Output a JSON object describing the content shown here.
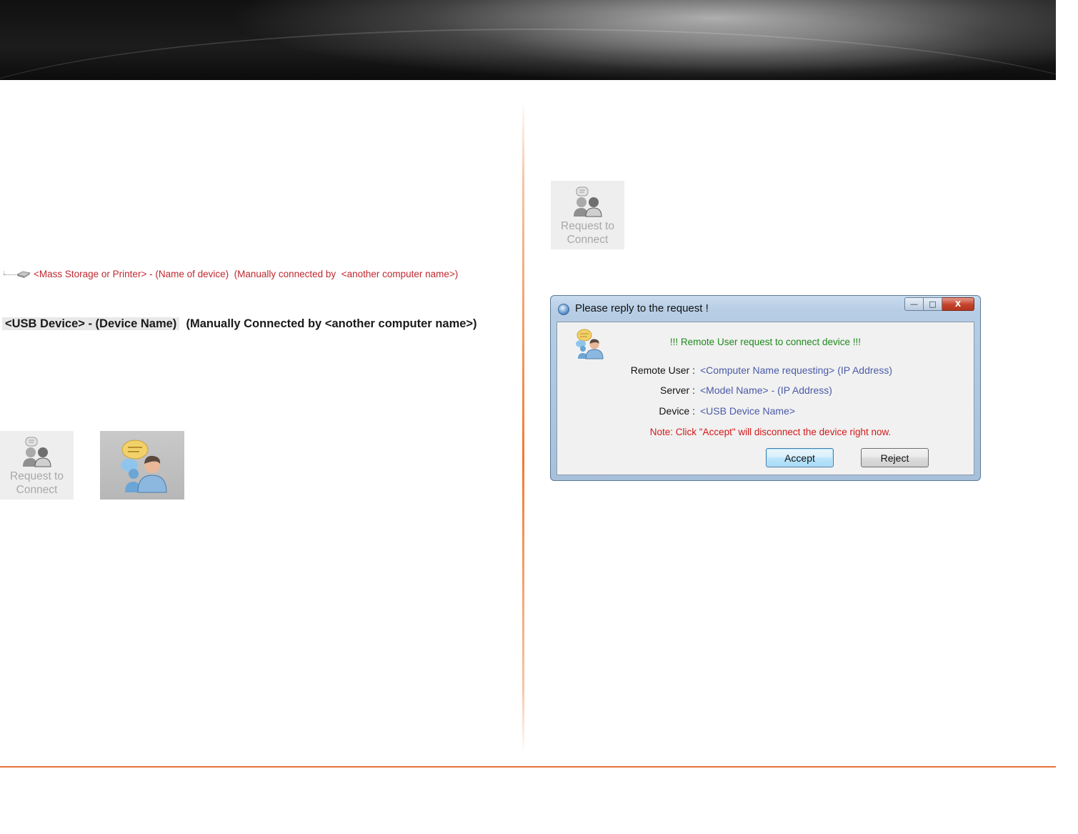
{
  "left": {
    "tree_item": "<Mass Storage or Printer> - (Name of device)  (Manually connected by  <another computer name>)",
    "usb_line": {
      "device": "<USB Device> - (Device Name)",
      "connected_label": "(Manually Connected by",
      "connected_value": "<another computer name>)"
    },
    "request_button": {
      "line1": "Request to",
      "line2": "Connect",
      "icon": "request-connect-icon"
    },
    "large_icon": "request-connect-large-icon"
  },
  "right": {
    "request_button": {
      "line1": "Request to",
      "line2": "Connect",
      "icon": "request-connect-icon"
    },
    "dialog": {
      "title": "Please reply to the request !",
      "window_buttons": {
        "minimize": "—",
        "maximize": "□",
        "close": "X"
      },
      "headline": "!!! Remote User request to connect device !!!",
      "fields": [
        {
          "label": "Remote User :",
          "value": "<Computer Name requesting> (IP Address)"
        },
        {
          "label": "Server :",
          "value": "<Model Name> - (IP Address)"
        },
        {
          "label": "Device :",
          "value": "<USB Device Name>"
        }
      ],
      "note": "Note: Click \"Accept\" will disconnect the device right now.",
      "accept_label": "Accept",
      "reject_label": "Reject"
    }
  },
  "colors": {
    "accent_orange": "#e8733a",
    "tree_text_red": "#c0282f",
    "headline_green": "#1e8a1e",
    "value_blue": "#4a5aa8",
    "note_red": "#d31919"
  }
}
